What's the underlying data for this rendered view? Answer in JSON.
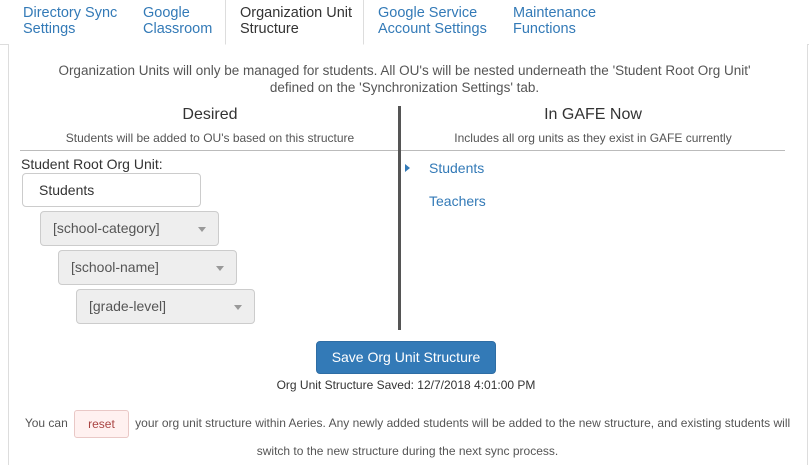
{
  "tabs": [
    {
      "line1": "Directory Sync",
      "line2": "Settings"
    },
    {
      "line1": "Google",
      "line2": "Classroom"
    },
    {
      "line1": "Organization Unit",
      "line2": "Structure"
    },
    {
      "line1": "Google Service",
      "line2": "Account Settings"
    },
    {
      "line1": "Maintenance",
      "line2": "Functions"
    }
  ],
  "intro": {
    "line1": "Organization Units will only be managed for students. All OU's will be nested underneath the 'Student Root Org Unit'",
    "line2": "defined on the 'Synchronization Settings' tab."
  },
  "desired": {
    "title": "Desired",
    "subtitle": "Students will be added to OU's based on this structure",
    "root_label": "Student Root Org Unit:",
    "root_value": "Students",
    "levels": [
      "[school-category]",
      "[school-name]",
      "[grade-level]"
    ]
  },
  "gafe": {
    "title": "In GAFE Now",
    "subtitle": "Includes all org units as they exist in GAFE currently",
    "units": [
      "Students",
      "Teachers"
    ]
  },
  "save": {
    "button_label": "Save Org Unit Structure",
    "status": "Org Unit Structure Saved: 12/7/2018 4:01:00 PM"
  },
  "reset": {
    "prefix": "You can",
    "button_label": "reset",
    "suffix": "your org unit structure within Aeries. Any newly added students will be added to the new structure, and existing students will switch to the new structure during the next sync process."
  },
  "colors": {
    "link": "#337ab7",
    "primary_button": "#337ab7",
    "reset_button_bg": "#fff1f0"
  },
  "icons": {
    "select_caret": "caret-down-icon",
    "tree_expand": "caret-right-icon"
  }
}
